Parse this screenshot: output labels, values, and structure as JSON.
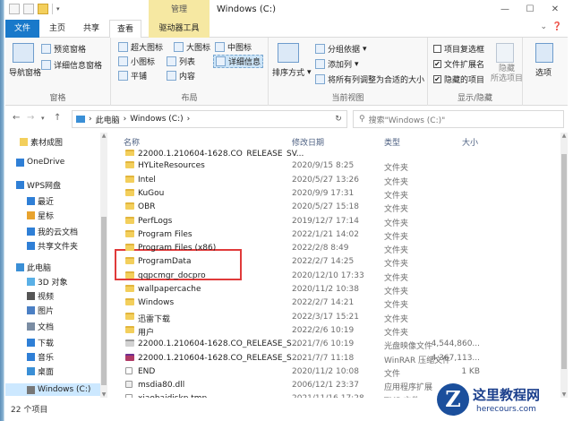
{
  "window": {
    "title": "Windows (C:)",
    "tool_tab": "管理",
    "controls": {
      "minimize": "—",
      "maximize": "☐",
      "close": "✕"
    }
  },
  "tabs": [
    "文件",
    "主页",
    "共享",
    "查看",
    "驱动器工具"
  ],
  "ribbon": {
    "panes": {
      "nav_pane": "导航窗格",
      "preview_pane": "预览窗格",
      "details_pane": "详细信息窗格",
      "label": "窗格"
    },
    "layout": {
      "items": [
        "超大图标",
        "大图标",
        "中图标",
        "小图标",
        "列表",
        "详细信息",
        "平铺",
        "内容"
      ],
      "label": "布局"
    },
    "current_view": {
      "sort_by": "排序方式",
      "group_by": "分组依据",
      "add_columns": "添加列",
      "size_all": "将所有列调整为合适的大小",
      "label": "当前视图"
    },
    "show_hide": {
      "item_checkboxes": "项目复选框",
      "file_extensions": "文件扩展名",
      "hidden_items": "隐藏的项目",
      "hide_selected": "隐藏\n所选项目",
      "label": "显示/隐藏",
      "checks": {
        "item_checkboxes": false,
        "file_extensions": true,
        "hidden_items": true
      }
    },
    "options": "选项"
  },
  "address": {
    "path": [
      "此电脑",
      "Windows (C:)"
    ],
    "search_placeholder": "搜索\"Windows (C:)\""
  },
  "nav_tree": [
    {
      "label": "素材成图",
      "icon": "folder-icon",
      "selected": false
    },
    {
      "label": "OneDrive",
      "icon": "cloud-icon",
      "selected": false
    },
    {
      "label": "WPS网盘",
      "icon": "cloud-icon",
      "selected": false
    },
    {
      "label": "最近",
      "icon": "clock-icon",
      "selected": false
    },
    {
      "label": "星标",
      "icon": "star-icon",
      "selected": false
    },
    {
      "label": "我的云文档",
      "icon": "cloud-icon",
      "selected": false
    },
    {
      "label": "共享文件夹",
      "icon": "share-icon",
      "selected": false
    },
    {
      "label": "此电脑",
      "icon": "computer-icon",
      "selected": false
    },
    {
      "label": "3D 对象",
      "icon": "cube-icon",
      "selected": false
    },
    {
      "label": "视频",
      "icon": "video-icon",
      "selected": false
    },
    {
      "label": "图片",
      "icon": "picture-icon",
      "selected": false
    },
    {
      "label": "文档",
      "icon": "document-icon",
      "selected": false
    },
    {
      "label": "下载",
      "icon": "download-icon",
      "selected": false
    },
    {
      "label": "音乐",
      "icon": "music-icon",
      "selected": false
    },
    {
      "label": "桌面",
      "icon": "desktop-icon",
      "selected": false
    },
    {
      "label": "Windows (C:)",
      "icon": "drive-icon",
      "selected": true
    }
  ],
  "columns": [
    "名称",
    "修改日期",
    "类型",
    "大小"
  ],
  "files": [
    {
      "name": "22000.1.210604-1628.CO_RELEASE_SV...",
      "date": "",
      "type": "",
      "size": "",
      "icon": "folder-icon"
    },
    {
      "name": "HYLiteResources",
      "date": "2020/9/15 8:25",
      "type": "文件夹",
      "size": "",
      "icon": "folder-icon"
    },
    {
      "name": "Intel",
      "date": "2020/5/27 13:26",
      "type": "文件夹",
      "size": "",
      "icon": "folder-icon"
    },
    {
      "name": "KuGou",
      "date": "2020/9/9 17:31",
      "type": "文件夹",
      "size": "",
      "icon": "folder-icon"
    },
    {
      "name": "OBR",
      "date": "2020/5/27 15:18",
      "type": "文件夹",
      "size": "",
      "icon": "folder-icon"
    },
    {
      "name": "PerfLogs",
      "date": "2019/12/7 17:14",
      "type": "文件夹",
      "size": "",
      "icon": "folder-icon"
    },
    {
      "name": "Program Files",
      "date": "2022/1/21 14:02",
      "type": "文件夹",
      "size": "",
      "icon": "folder-icon"
    },
    {
      "name": "Program Files (x86)",
      "date": "2022/2/8 8:49",
      "type": "文件夹",
      "size": "",
      "icon": "folder-icon"
    },
    {
      "name": "ProgramData",
      "date": "2022/2/7 14:25",
      "type": "文件夹",
      "size": "",
      "icon": "folder-icon"
    },
    {
      "name": "qqpcmgr_docpro",
      "date": "2020/12/10 17:33",
      "type": "文件夹",
      "size": "",
      "icon": "folder-icon"
    },
    {
      "name": "wallpapercache",
      "date": "2020/11/2 10:38",
      "type": "文件夹",
      "size": "",
      "icon": "folder-icon"
    },
    {
      "name": "Windows",
      "date": "2022/2/7 14:21",
      "type": "文件夹",
      "size": "",
      "icon": "folder-icon"
    },
    {
      "name": "迅雷下载",
      "date": "2022/3/17 15:21",
      "type": "文件夹",
      "size": "",
      "icon": "folder-icon"
    },
    {
      "name": "用户",
      "date": "2022/2/6 10:19",
      "type": "文件夹",
      "size": "",
      "icon": "folder-icon"
    },
    {
      "name": "22000.1.210604-1628.CO_RELEASE_S...",
      "date": "2021/7/6 10:19",
      "type": "光盘映像文件",
      "size": "4,544,860...",
      "icon": "disc-image-icon"
    },
    {
      "name": "22000.1.210604-1628.CO_RELEASE_S...",
      "date": "2021/7/7 11:18",
      "type": "WinRAR 压缩文件",
      "size": "4,367,113...",
      "icon": "archive-icon"
    },
    {
      "name": "END",
      "date": "2020/11/2 10:08",
      "type": "文件",
      "size": "1 KB",
      "icon": "file-icon"
    },
    {
      "name": "msdia80.dll",
      "date": "2006/12/1 23:37",
      "type": "应用程序扩展",
      "size": "",
      "icon": "dll-icon"
    },
    {
      "name": "xiaobaidiskp.tmp",
      "date": "2021/11/16 17:28",
      "type": "TMP 文件",
      "size": "",
      "icon": "file-icon"
    }
  ],
  "status": {
    "count": "22 个项目"
  },
  "watermark": {
    "logo_letter": "Z",
    "title": "这里教程网",
    "url": "herecours.com"
  }
}
